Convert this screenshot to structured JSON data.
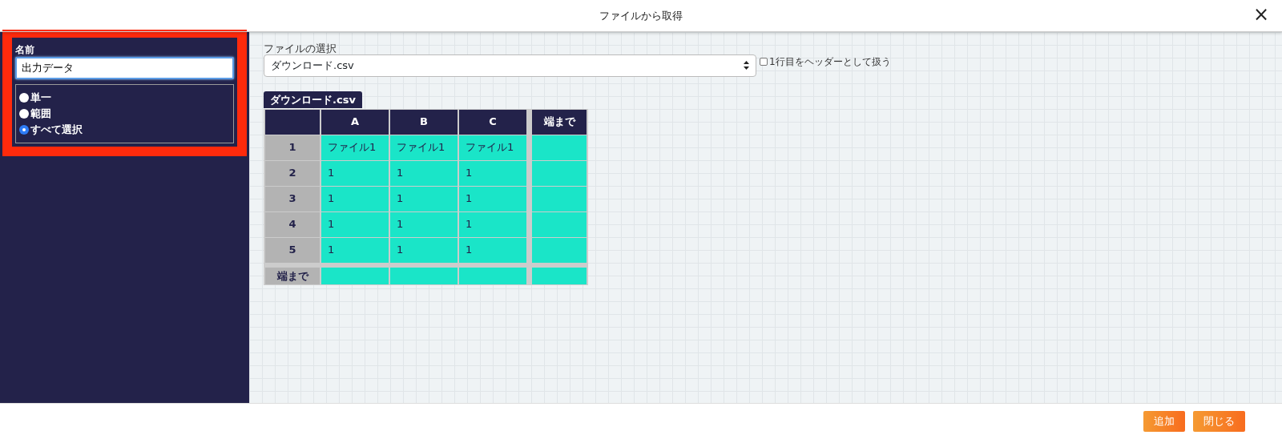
{
  "dialog": {
    "title": "ファイルから取得",
    "close": "×"
  },
  "sidebar": {
    "name_label": "名前",
    "name_value": "出力データ",
    "options": [
      {
        "label": "単一",
        "selected": false
      },
      {
        "label": "範囲",
        "selected": false
      },
      {
        "label": "すべて選択",
        "selected": true
      }
    ]
  },
  "file_select": {
    "label": "ファイルの選択",
    "value": "ダウンロード.csv"
  },
  "header_checkbox": {
    "label": "1行目をヘッダーとして扱う",
    "checked": false
  },
  "sheet_tab": "ダウンロード.csv",
  "table": {
    "columns": [
      "A",
      "B",
      "C"
    ],
    "end_column": "端まで",
    "rows": [
      {
        "label": "1",
        "cells": [
          "ファイル1",
          "ファイル1",
          "ファイル1"
        ]
      },
      {
        "label": "2",
        "cells": [
          "1",
          "1",
          "1"
        ]
      },
      {
        "label": "3",
        "cells": [
          "1",
          "1",
          "1"
        ]
      },
      {
        "label": "4",
        "cells": [
          "1",
          "1",
          "1"
        ]
      },
      {
        "label": "5",
        "cells": [
          "1",
          "1",
          "1"
        ]
      }
    ],
    "end_row": "端まで"
  },
  "buttons": [
    "追加",
    "閉じる"
  ]
}
